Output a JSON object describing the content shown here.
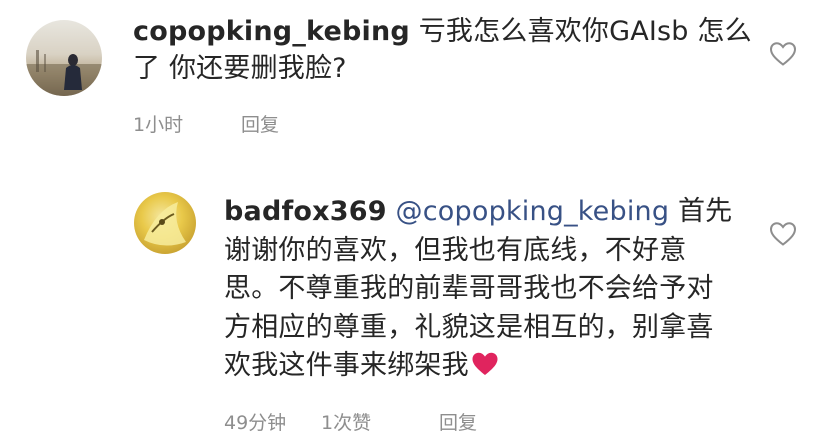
{
  "comments": [
    {
      "username": "copopking_kebing",
      "body": " 亏我怎么喜欢你GAIsb 怎么了 你还要删我脸?",
      "time": "1小时",
      "reply_label": "回复",
      "avatar_icon": "avatar-photo-silhouette"
    },
    {
      "username": "badfox369",
      "mention": "@copopking_kebing",
      "body": " 首先谢谢你的喜欢，但我也有底线，不好意思。不尊重我的前辈哥哥我也不会给予对方相应的尊重，礼貌这是相互的，别拿喜欢我这件事来绑架我",
      "emoji": "red-heart-emoji",
      "time": "49分钟",
      "likes": "1次赞",
      "reply_label": "回复",
      "avatar_icon": "avatar-yellow-illustration"
    }
  ],
  "colors": {
    "mention": "#385185",
    "meta": "#8e8e8e",
    "text": "#262626",
    "heart": "#e0245e"
  },
  "icons": {
    "like": "heart-outline-icon"
  }
}
